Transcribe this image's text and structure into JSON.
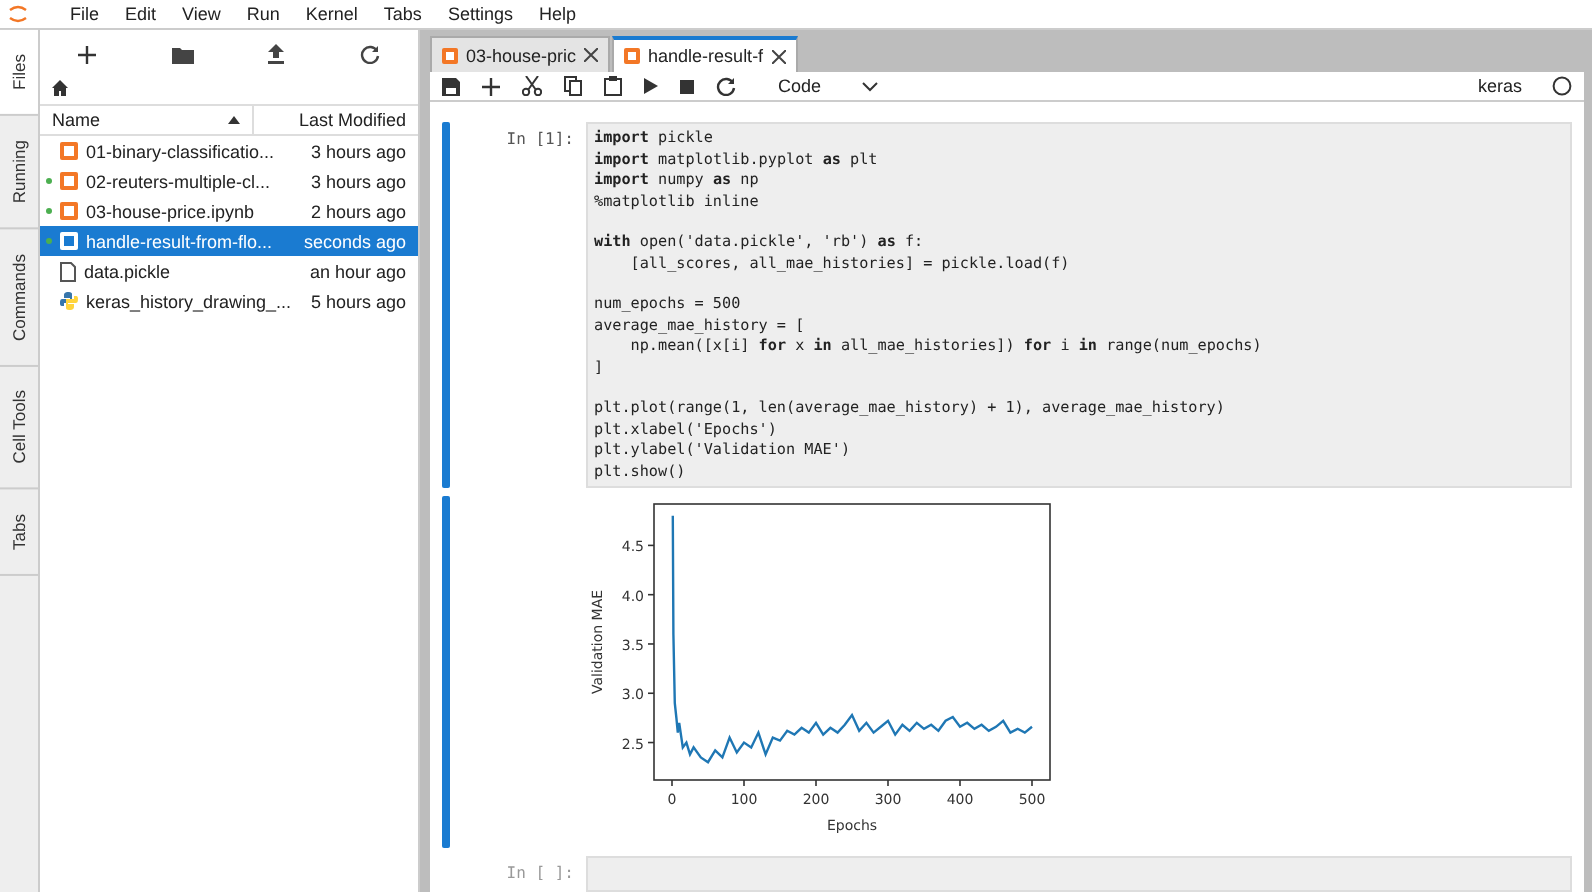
{
  "menu": [
    "File",
    "Edit",
    "View",
    "Run",
    "Kernel",
    "Tabs",
    "Settings",
    "Help"
  ],
  "side_tabs": [
    {
      "label": "Files",
      "selected": true
    },
    {
      "label": "Running",
      "selected": false
    },
    {
      "label": "Commands",
      "selected": false
    },
    {
      "label": "Cell Tools",
      "selected": false
    },
    {
      "label": "Tabs",
      "selected": false
    }
  ],
  "file_browser": {
    "columns": [
      {
        "label": "Name",
        "sorted": true
      },
      {
        "label": "Last Modified",
        "sorted": false
      }
    ],
    "files": [
      {
        "name": "01-binary-classificatio...",
        "modified": "3 hours ago",
        "kind": "notebook",
        "running": false,
        "selected": false
      },
      {
        "name": "02-reuters-multiple-cl...",
        "modified": "3 hours ago",
        "kind": "notebook",
        "running": true,
        "selected": false
      },
      {
        "name": "03-house-price.ipynb",
        "modified": "2 hours ago",
        "kind": "notebook",
        "running": true,
        "selected": false
      },
      {
        "name": "handle-result-from-flo...",
        "modified": "seconds ago",
        "kind": "notebook",
        "running": true,
        "selected": true
      },
      {
        "name": "data.pickle",
        "modified": "an hour ago",
        "kind": "file",
        "running": false,
        "selected": false
      },
      {
        "name": "keras_history_drawing_...",
        "modified": "5 hours ago",
        "kind": "python",
        "running": false,
        "selected": false
      }
    ]
  },
  "doc_tabs": [
    {
      "label": "03-house-pric",
      "selected": false
    },
    {
      "label": "handle-result-f",
      "selected": true
    }
  ],
  "toolbar": {
    "cell_type": "Code",
    "kernel": "keras"
  },
  "cells": [
    {
      "prompt": "In [1]:",
      "code": [
        [
          "**import** pickle",
          "**import** matplotlib.pyplot **as** plt",
          "**import** numpy **as** np",
          "%matplotlib inline"
        ],
        [
          "**with** open('data.pickle', 'rb') **as** f:",
          "    [all_scores, all_mae_histories] = pickle.load(f)"
        ],
        [
          "num_epochs = 500",
          "average_mae_history = [",
          "    np.mean([x[i] **for** x **in** all_mae_histories]) **for** i **in** range(num_epochs)",
          "]"
        ],
        [
          "plt.plot(range(1, len(average_mae_history) + 1), average_mae_history)",
          "plt.xlabel('Epochs')",
          "plt.ylabel('Validation MAE')",
          "plt.show()"
        ]
      ],
      "output": {
        "chart_data": {
          "type": "line",
          "xlabel": "Epochs",
          "ylabel": "Validation MAE",
          "xlim": [
            -25,
            525
          ],
          "ylim": [
            2.12,
            4.92
          ],
          "xticks": [
            0,
            100,
            200,
            300,
            400,
            500
          ],
          "yticks": [
            2.5,
            {
              "value": 3,
              "label": "3.0"
            },
            3.5,
            {
              "value": 4,
              "label": "4.0"
            },
            4.5
          ],
          "x": [
            1,
            2,
            4,
            6,
            8,
            10,
            15,
            20,
            25,
            30,
            40,
            50,
            60,
            70,
            80,
            90,
            100,
            110,
            120,
            130,
            140,
            150,
            160,
            170,
            180,
            190,
            200,
            210,
            220,
            230,
            240,
            250,
            260,
            270,
            280,
            290,
            300,
            310,
            320,
            330,
            340,
            350,
            360,
            370,
            380,
            390,
            400,
            410,
            420,
            430,
            440,
            450,
            460,
            470,
            480,
            490,
            500
          ],
          "series": [
            {
              "color": "#1f77b4",
              "values": [
                4.8,
                3.6,
                2.9,
                2.75,
                2.6,
                2.7,
                2.45,
                2.5,
                2.38,
                2.45,
                2.35,
                2.3,
                2.42,
                2.35,
                2.55,
                2.4,
                2.5,
                2.45,
                2.6,
                2.38,
                2.55,
                2.52,
                2.62,
                2.58,
                2.65,
                2.6,
                2.7,
                2.58,
                2.65,
                2.6,
                2.68,
                2.78,
                2.62,
                2.7,
                2.6,
                2.66,
                2.72,
                2.58,
                2.68,
                2.62,
                2.7,
                2.64,
                2.68,
                2.62,
                2.72,
                2.76,
                2.66,
                2.7,
                2.64,
                2.68,
                2.62,
                2.66,
                2.72,
                2.6,
                2.64,
                2.6,
                2.66
              ]
            }
          ]
        }
      }
    },
    {
      "prompt": "In [ ]:"
    }
  ]
}
